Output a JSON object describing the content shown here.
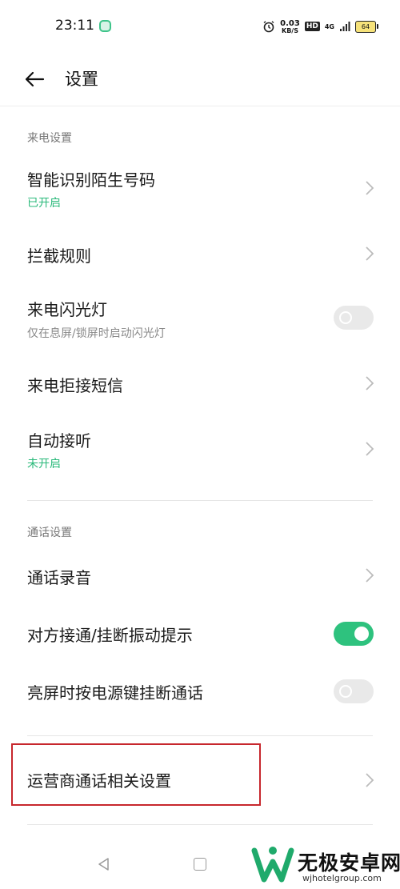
{
  "status_bar": {
    "time": "23:11",
    "net_speed_value": "0.03",
    "net_speed_unit": "KB/S",
    "hd_label": "HD",
    "network_label": "4G",
    "battery": "64"
  },
  "header": {
    "title": "设置"
  },
  "sections": [
    {
      "title": "来电设置",
      "items": [
        {
          "label": "智能识别陌生号码",
          "sub": "已开启",
          "control": "chevron"
        },
        {
          "label": "拦截规则",
          "control": "chevron"
        },
        {
          "label": "来电闪光灯",
          "sub": "仅在息屏/锁屏时启动闪光灯",
          "control": "toggle",
          "toggle_on": false
        },
        {
          "label": "来电拒接短信",
          "control": "chevron"
        },
        {
          "label": "自动接听",
          "sub": "未开启",
          "control": "chevron"
        }
      ]
    },
    {
      "title": "通话设置",
      "items": [
        {
          "label": "通话录音",
          "control": "chevron"
        },
        {
          "label": "对方接通/挂断振动提示",
          "control": "toggle",
          "toggle_on": true
        },
        {
          "label": "亮屏时按电源键挂断通话",
          "control": "toggle",
          "toggle_on": false
        }
      ]
    },
    {
      "items": [
        {
          "label": "运营商通话相关设置",
          "control": "chevron"
        }
      ]
    }
  ],
  "watermark": {
    "name": "无极安卓网",
    "url": "wjhotelgroup.com"
  },
  "colors": {
    "accent": "#2ec27e",
    "status_green": "#2ab97a",
    "highlight_border": "#c7272d"
  }
}
